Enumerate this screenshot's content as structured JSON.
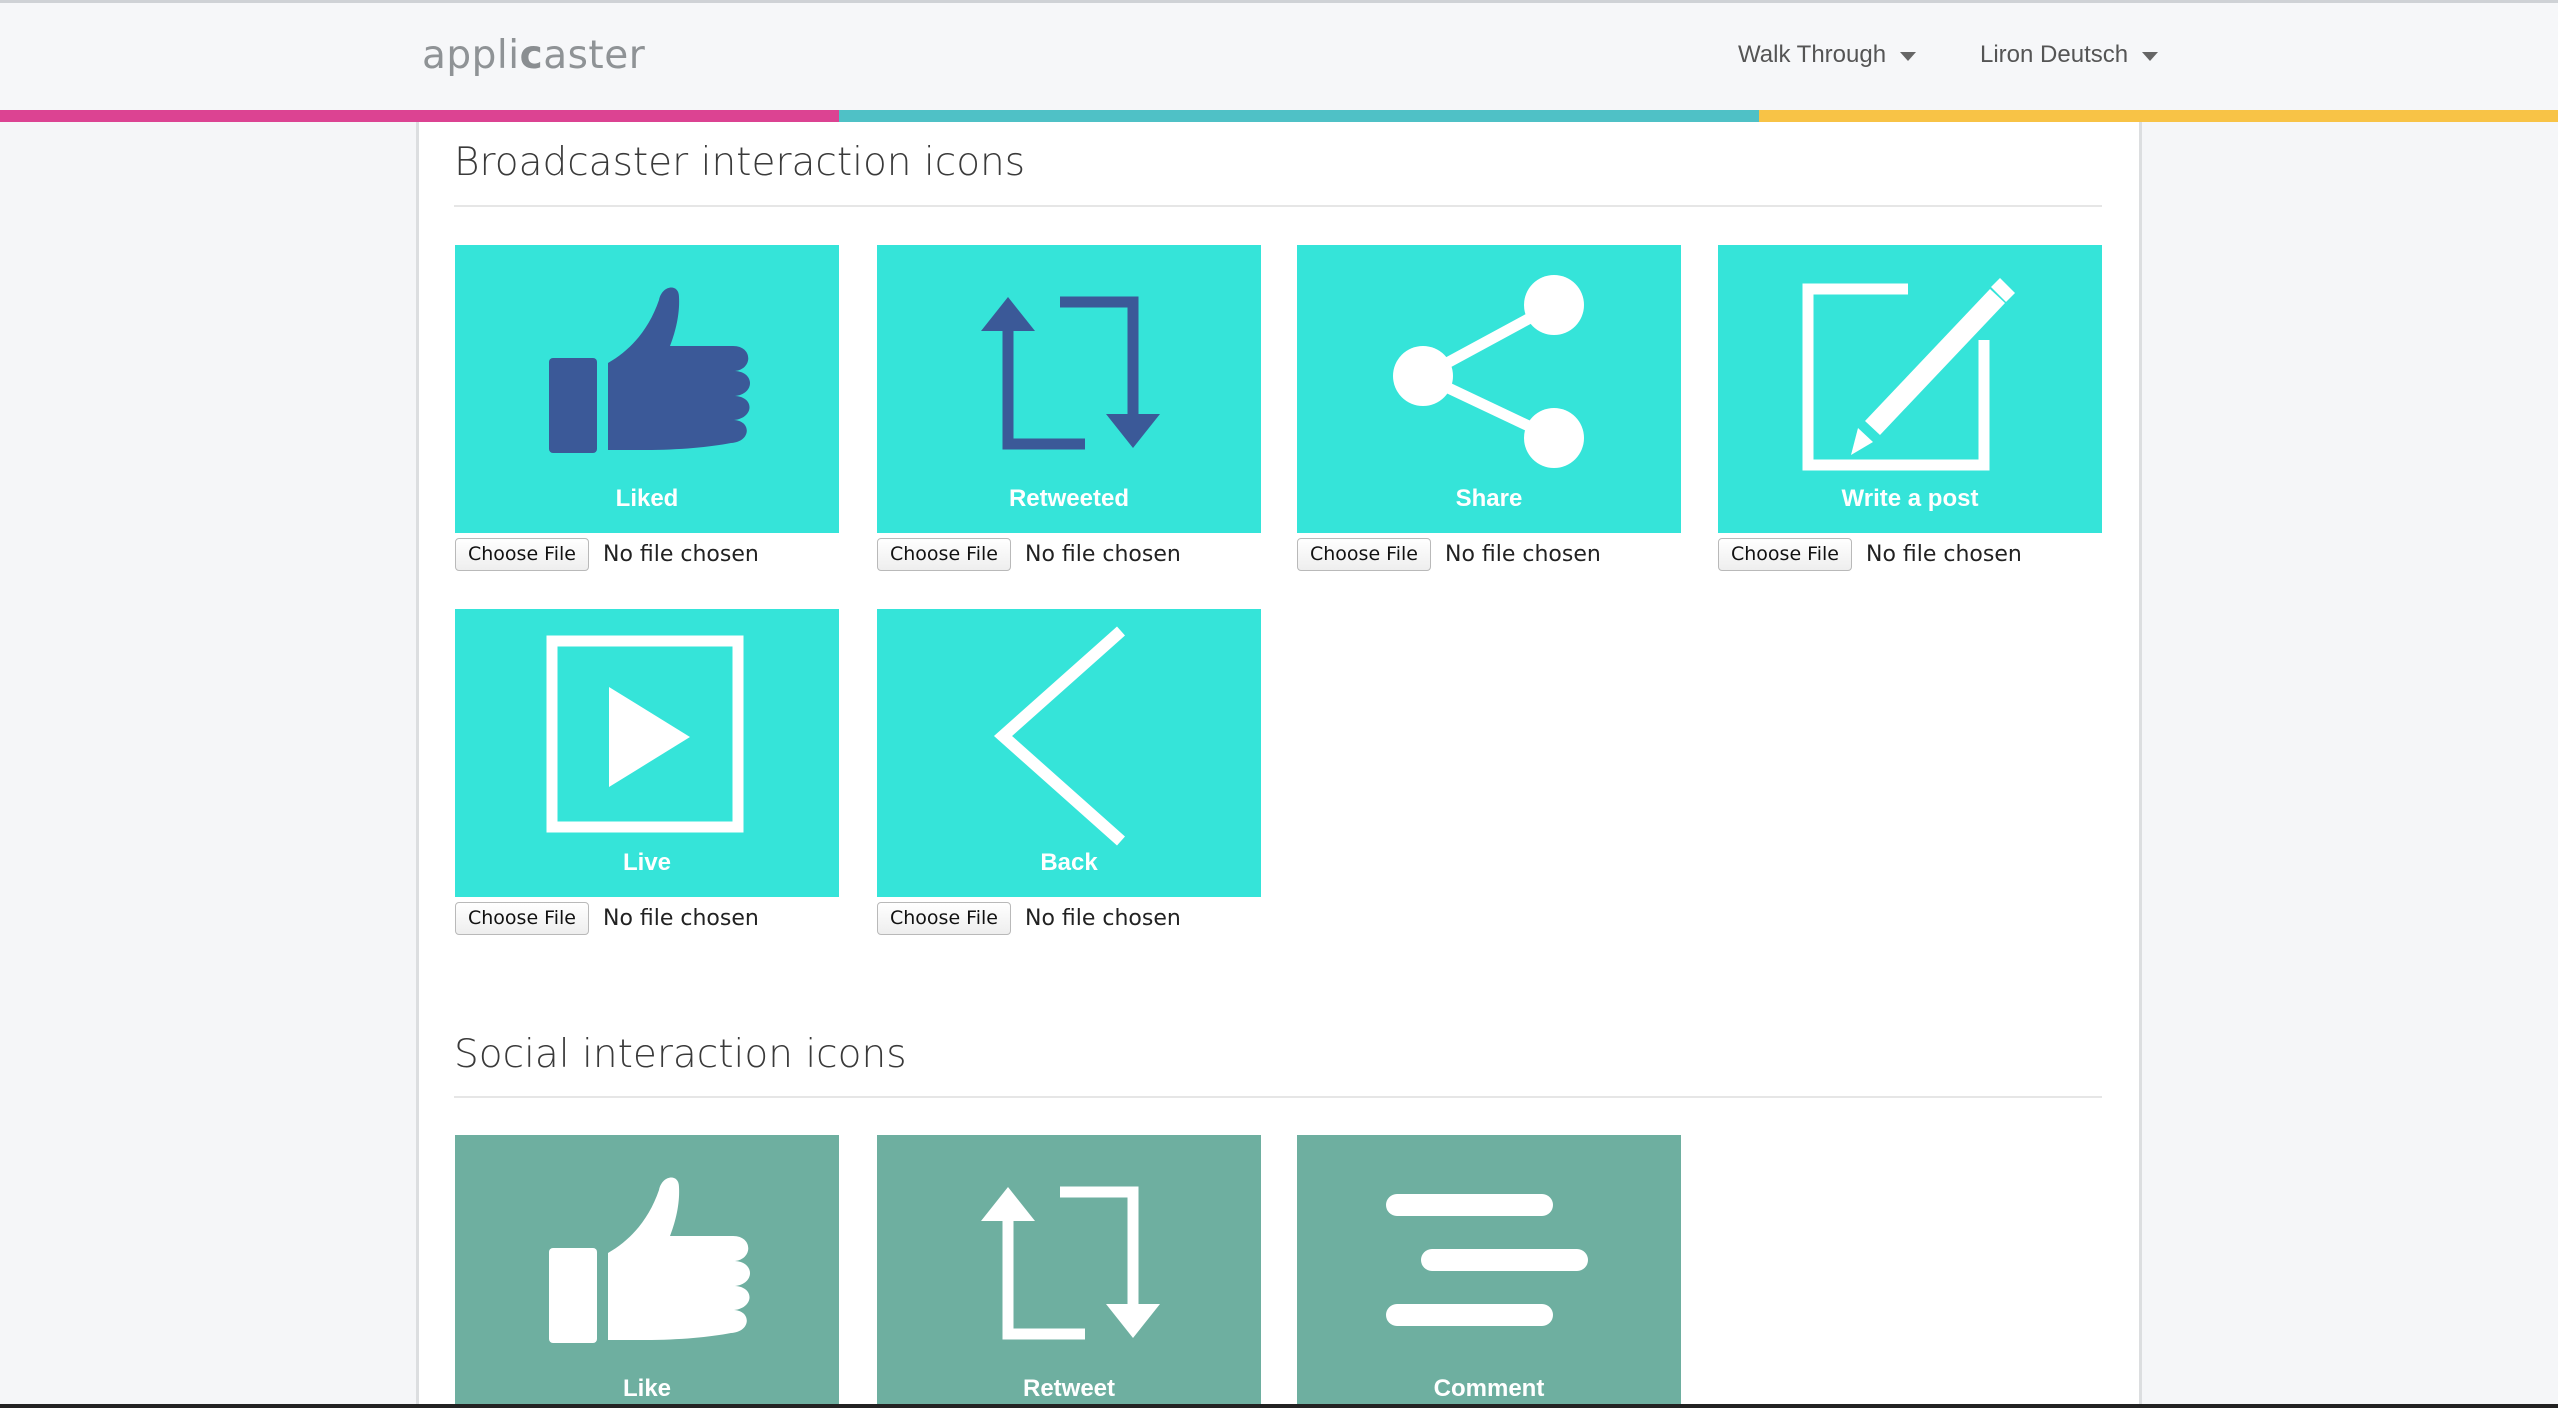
{
  "navbar": {
    "logo_text_1": "appli",
    "logo_text_2": "c",
    "logo_text_3": "aster",
    "menu_walkthrough": "Walk Through",
    "menu_user": "Liron Deutsch"
  },
  "stripe_colors": [
    "#dc4392",
    "#4fc1c6",
    "#f8c346"
  ],
  "colors": {
    "tile_broadcaster": "#35e4d9",
    "tile_social": "#6eafa0",
    "icon_dark": "#3b5998"
  },
  "sections": [
    {
      "title": "Broadcaster interaction icons",
      "tiles": [
        {
          "label": "Liked",
          "icon": "thumbs-up-icon",
          "button": "Choose File",
          "status": "No file chosen"
        },
        {
          "label": "Retweeted",
          "icon": "retweet-icon",
          "button": "Choose File",
          "status": "No file chosen"
        },
        {
          "label": "Share",
          "icon": "share-icon",
          "button": "Choose File",
          "status": "No file chosen"
        },
        {
          "label": "Write a post",
          "icon": "edit-icon",
          "button": "Choose File",
          "status": "No file chosen"
        },
        {
          "label": "Live",
          "icon": "play-icon",
          "button": "Choose File",
          "status": "No file chosen"
        },
        {
          "label": "Back",
          "icon": "chevron-left-icon",
          "button": "Choose File",
          "status": "No file chosen"
        }
      ]
    },
    {
      "title": "Social interaction icons",
      "tiles": [
        {
          "label": "Like",
          "icon": "thumbs-up-icon"
        },
        {
          "label": "Retweet",
          "icon": "retweet-icon"
        },
        {
          "label": "Comment",
          "icon": "comment-lines-icon"
        }
      ]
    }
  ]
}
